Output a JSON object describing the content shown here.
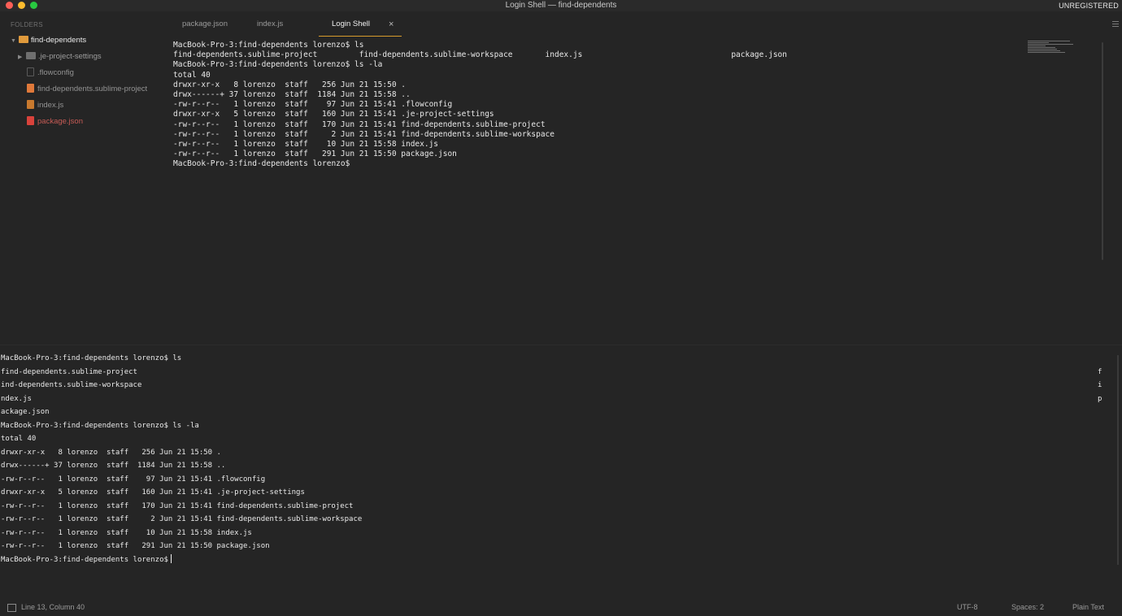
{
  "window": {
    "title": "Login Shell — find-dependents",
    "registration": "UNREGISTERED"
  },
  "sidebar": {
    "header": "FOLDERS",
    "root_folder": "find-dependents",
    "items": [
      {
        "label": ".je-project-settings",
        "icon": "folder-icon",
        "color": "#6f6f6f"
      },
      {
        "label": ".flowconfig",
        "icon": "file-icon",
        "color": "#5a5a5a"
      },
      {
        "label": "find-dependents.sublime-project",
        "icon": "sublime-file-icon",
        "color": "#e0793a"
      },
      {
        "label": "index.js",
        "icon": "js-file-icon",
        "color": "#c8792e"
      },
      {
        "label": "package.json",
        "icon": "json-file-icon",
        "color": "#d9423b"
      }
    ]
  },
  "tabs": [
    {
      "label": "package.json"
    },
    {
      "label": "index.js"
    },
    {
      "label": "Login Shell"
    }
  ],
  "tab_close_glyph": "×",
  "editor": {
    "lines": [
      "MacBook-Pro-3:find-dependents lorenzo$ ls",
      "find-dependents.sublime-project         find-dependents.sublime-workspace       index.js                                package.json",
      "MacBook-Pro-3:find-dependents lorenzo$ ls -la",
      "total 40",
      "drwxr-xr-x   8 lorenzo  staff   256 Jun 21 15:50 .",
      "drwx------+ 37 lorenzo  staff  1184 Jun 21 15:58 ..",
      "-rw-r--r--   1 lorenzo  staff    97 Jun 21 15:41 .flowconfig",
      "drwxr-xr-x   5 lorenzo  staff   160 Jun 21 15:41 .je-project-settings",
      "-rw-r--r--   1 lorenzo  staff   170 Jun 21 15:41 find-dependents.sublime-project",
      "-rw-r--r--   1 lorenzo  staff     2 Jun 21 15:41 find-dependents.sublime-workspace",
      "-rw-r--r--   1 lorenzo  staff    10 Jun 21 15:58 index.js",
      "-rw-r--r--   1 lorenzo  staff   291 Jun 21 15:50 package.json",
      "MacBook-Pro-3:find-dependents lorenzo$"
    ]
  },
  "panel": {
    "lines": [
      "MacBook-Pro-3:find-dependents lorenzo$ ls",
      "find-dependents.sublime-project",
      "ind-dependents.sublime-workspace",
      "ndex.js",
      "ackage.json",
      "MacBook-Pro-3:find-dependents lorenzo$ ls -la",
      "total 40",
      "drwxr-xr-x   8 lorenzo  staff   256 Jun 21 15:50 .",
      "drwx------+ 37 lorenzo  staff  1184 Jun 21 15:58 ..",
      "-rw-r--r--   1 lorenzo  staff    97 Jun 21 15:41 .flowconfig",
      "drwxr-xr-x   5 lorenzo  staff   160 Jun 21 15:41 .je-project-settings",
      "-rw-r--r--   1 lorenzo  staff   170 Jun 21 15:41 find-dependents.sublime-project",
      "-rw-r--r--   1 lorenzo  staff     2 Jun 21 15:41 find-dependents.sublime-workspace",
      "-rw-r--r--   1 lorenzo  staff    10 Jun 21 15:58 index.js",
      "-rw-r--r--   1 lorenzo  staff   291 Jun 21 15:50 package.json",
      "MacBook-Pro-3:find-dependents lorenzo$"
    ],
    "wrapped_chars": [
      "f",
      "i",
      "p"
    ]
  },
  "status": {
    "position": "Line 13, Column 40",
    "encoding": "UTF-8",
    "indentation": "Spaces: 2",
    "syntax": "Plain Text"
  },
  "colors": {
    "background": "#252525",
    "active_tab_underline": "#d79b2c",
    "folder_open": "#e09a3c"
  }
}
